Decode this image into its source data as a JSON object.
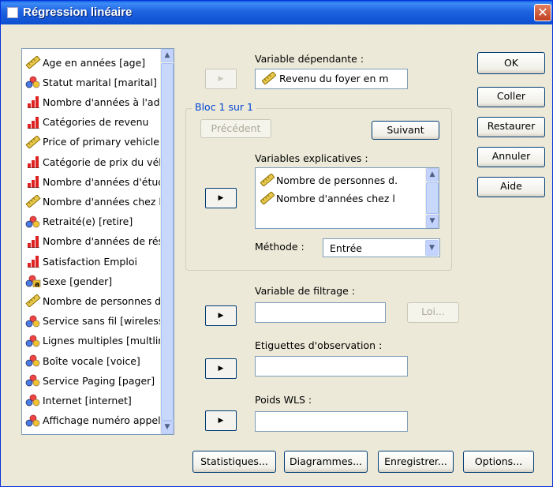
{
  "window": {
    "title": "Régression linéaire",
    "close_label": "✕"
  },
  "source_list": {
    "items": [
      {
        "label": "Age en années [age]",
        "icon": "scale-icon"
      },
      {
        "label": "Statut marital [marital]",
        "icon": "nominal-icon"
      },
      {
        "label": "Nombre d'années à l'adresse actuelle",
        "icon": "ordinal-icon"
      },
      {
        "label": "Catégories de revenu",
        "icon": "ordinal-icon"
      },
      {
        "label": "Price of primary vehicle",
        "icon": "scale-icon"
      },
      {
        "label": "Catégorie de prix du véhicule",
        "icon": "ordinal-icon"
      },
      {
        "label": "Nombre d'années d'études",
        "icon": "ordinal-icon"
      },
      {
        "label": "Nombre d'années chez l'employeur",
        "icon": "scale-icon"
      },
      {
        "label": "Retraité(e) [retire]",
        "icon": "nominal-icon"
      },
      {
        "label": "Nombre d'années de résidence",
        "icon": "ordinal-icon"
      },
      {
        "label": "Satisfaction Emploi",
        "icon": "ordinal-icon"
      },
      {
        "label": "Sexe [gender]",
        "icon": "nominal-string-icon"
      },
      {
        "label": "Nombre de personnes dans le foyer",
        "icon": "scale-icon"
      },
      {
        "label": "Service sans fil [wireless]",
        "icon": "nominal-icon"
      },
      {
        "label": "Lignes multiples [multline]",
        "icon": "nominal-icon"
      },
      {
        "label": "Boîte vocale [voice]",
        "icon": "nominal-icon"
      },
      {
        "label": "Service Paging [pager]",
        "icon": "nominal-icon"
      },
      {
        "label": "Internet [internet]",
        "icon": "nominal-icon"
      },
      {
        "label": "Affichage numéro appelant",
        "icon": "nominal-icon"
      }
    ]
  },
  "dependent": {
    "label": "Variable dépendante :",
    "value": "Revenu du foyer en m"
  },
  "block": {
    "title": "Bloc 1 sur 1",
    "previous_label": "Précédent",
    "next_label": "Suivant",
    "independents_label": "Variables explicatives :",
    "independents": [
      "Nombre de personnes d.",
      "Nombre d'années chez l"
    ],
    "method_label": "Méthode :",
    "method_value": "Entrée"
  },
  "filter": {
    "label": "Variable de filtrage :",
    "value": "",
    "rule_label": "Loi..."
  },
  "case_labels": {
    "label": "Etiguettes d'observation :",
    "value": ""
  },
  "wls": {
    "label": "Poids WLS :",
    "value": ""
  },
  "side_buttons": {
    "ok": "OK",
    "paste": "Coller",
    "reset": "Restaurer",
    "cancel": "Annuler",
    "help": "Aide"
  },
  "bottom_buttons": {
    "statistics": "Statistiques...",
    "plots": "Diagrammes...",
    "save": "Enregistrer...",
    "options": "Options..."
  },
  "arrow_glyph": "▶",
  "scroll_up_glyph": "▲",
  "scroll_down_glyph": "▼"
}
